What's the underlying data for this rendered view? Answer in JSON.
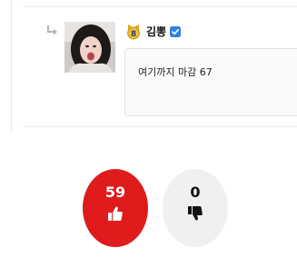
{
  "comment": {
    "author": {
      "name": "김뽕",
      "level": "8",
      "verified": true,
      "avatar_icon": "profile-photo"
    },
    "text": "여기까지 마감 67",
    "reply_icon": "reply-arrow-icon"
  },
  "votes": {
    "upvote": {
      "count": "59",
      "icon": "thumbs-up-icon",
      "color": "#df1b1b"
    },
    "downvote": {
      "count": "0",
      "icon": "thumbs-down-icon",
      "color": "#f0f0f0"
    }
  },
  "colors": {
    "verified": "#2f80e4",
    "badge_gold": "#d9a520",
    "badge_navy": "#2b3a67"
  }
}
